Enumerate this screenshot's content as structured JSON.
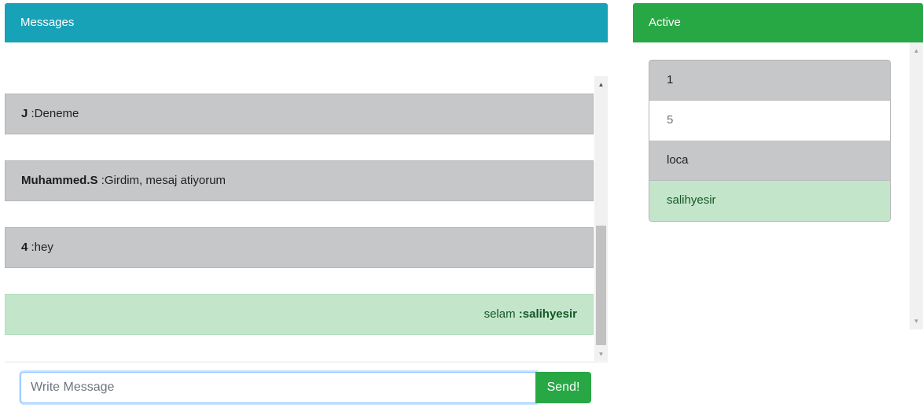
{
  "messages_panel": {
    "title": "Messages",
    "items": [
      {
        "sender": "J",
        "text": ":Deneme",
        "mine": false
      },
      {
        "sender": "Muhammed.S",
        "text": ":Girdim, mesaj atiyorum",
        "mine": false
      },
      {
        "sender": "4",
        "text": ":hey",
        "mine": false
      },
      {
        "sender": ":salihyesir",
        "text": "selam",
        "mine": true
      }
    ],
    "input": {
      "placeholder": "Write Message",
      "value": ""
    },
    "send_label": "Send!"
  },
  "active_panel": {
    "title": "Active",
    "users": [
      {
        "name": "1",
        "style": "gray"
      },
      {
        "name": "5",
        "style": "white"
      },
      {
        "name": "loca",
        "style": "gray"
      },
      {
        "name": "salihyesir",
        "style": "green"
      }
    ]
  },
  "colors": {
    "messages_header": "#17a2b8",
    "active_header": "#28a745",
    "send_button": "#28a745",
    "own_message_bg": "#c3e6cb",
    "other_message_bg": "#c6c7c9"
  },
  "icons": {
    "scroll_up": "scroll-up-arrow-icon",
    "scroll_down": "scroll-down-arrow-icon"
  }
}
